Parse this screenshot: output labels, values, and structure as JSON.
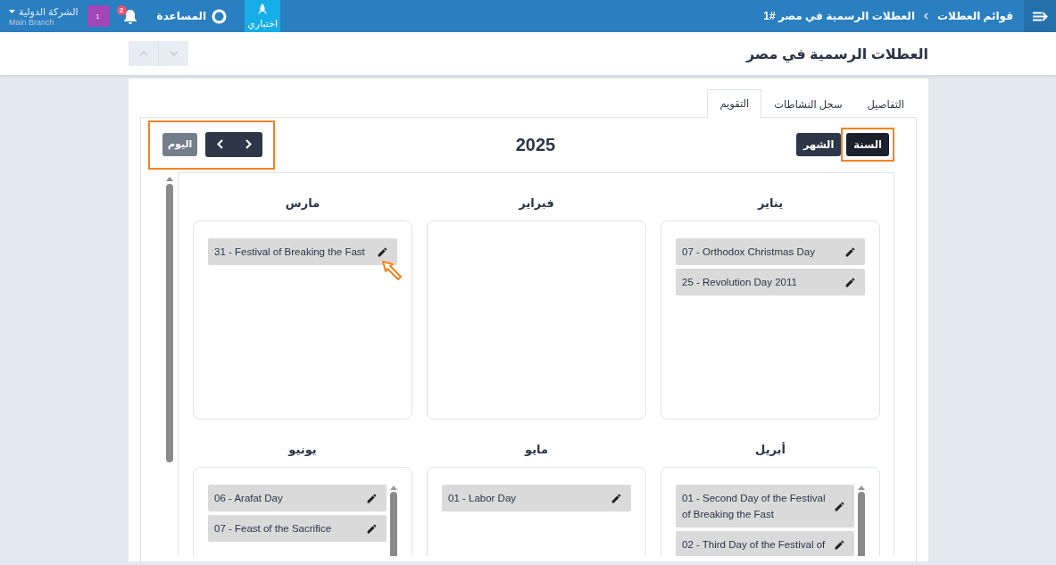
{
  "top_bar": {
    "breadcrumb": [
      "قوائم العطلات",
      "العطلات الرسمية في مصر #1"
    ],
    "quick_button": "اختباري",
    "help": "المساعدة",
    "notifications_badge": "2",
    "user_badge": "1",
    "company": "الشركة الدولية",
    "branch": "Main Branch"
  },
  "header": {
    "title": "العطلات الرسمية في مصر"
  },
  "tabs": [
    {
      "label": "التفاصيل",
      "selected": false
    },
    {
      "label": "سجل النشاطات",
      "selected": false
    },
    {
      "label": "التقويم",
      "selected": true
    }
  ],
  "calendar": {
    "views": [
      {
        "label": "السنة",
        "selected": true
      },
      {
        "label": "الشهر",
        "selected": false
      }
    ],
    "year": "2025",
    "today_button": "اليوم",
    "months": [
      {
        "name": "يناير",
        "scrollable": false,
        "holidays": [
          "07 - Orthodox Christmas Day",
          "25 - Revolution Day 2011"
        ]
      },
      {
        "name": "فبراير",
        "scrollable": false
      },
      {
        "name": "مارس",
        "scrollable": false,
        "holidays": [
          "31 - Festival of Breaking the Fast"
        ]
      },
      {
        "name": "أبريل",
        "scrollable": true,
        "holidays": [
          "01 - Second Day of the Festival of Breaking the Fast",
          "02 - Third Day of the Festival of"
        ]
      },
      {
        "name": "مايو",
        "scrollable": false,
        "holidays": [
          "01 - Labor Day"
        ]
      },
      {
        "name": "يونيو",
        "scrollable": true,
        "holidays": [
          "06 - Arafat Day",
          "07 - Feast of the Sacrifice"
        ]
      }
    ]
  }
}
